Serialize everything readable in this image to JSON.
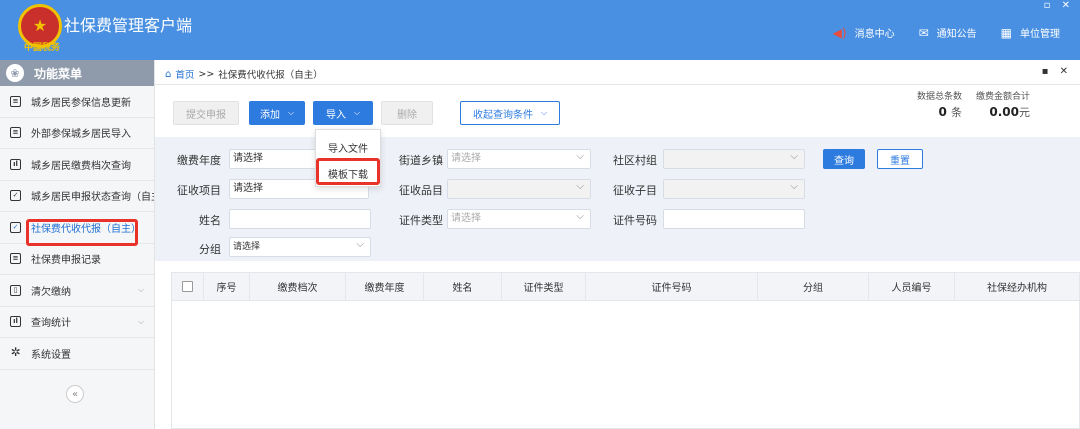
{
  "header": {
    "app_title": "社保费管理客户端",
    "logo_text": "中国税务",
    "messages": "消息中心",
    "notices": "通知公告",
    "unit_mgmt": "单位管理"
  },
  "sidebar": {
    "title": "功能菜单",
    "items": [
      {
        "label": "城乡居民参保信息更新"
      },
      {
        "label": "外部参保城乡居民导入"
      },
      {
        "label": "城乡居民缴费档次查询"
      },
      {
        "label": "城乡居民申报状态查询（自主）"
      },
      {
        "label": "社保费代收代报（自主）"
      },
      {
        "label": "社保费申报记录"
      },
      {
        "label": "清欠缴纳"
      },
      {
        "label": "查询统计"
      },
      {
        "label": "系统设置"
      }
    ]
  },
  "breadcrumb": {
    "home": "首页",
    "separator": ">>",
    "current": "社保费代收代报（自主）"
  },
  "toolbar": {
    "submit": "提交申报",
    "add": "添加",
    "import": "导入",
    "delete": "删除",
    "collapse_query": "收起查询条件"
  },
  "import_menu": {
    "items": [
      "导入文件",
      "模板下载"
    ]
  },
  "stats": {
    "count_label": "数据总条数",
    "count_value": "0",
    "count_unit": "条",
    "amount_label": "缴费金额合计",
    "amount_value": "0.00",
    "amount_unit": "元"
  },
  "filter": {
    "fee_year_label": "缴费年度",
    "fee_year_value": "请选择",
    "street_label": "街道乡镇",
    "street_placeholder": "请选择",
    "village_label": "社区村组",
    "query_btn": "查询",
    "reset_btn": "重置",
    "item_label": "征收项目",
    "item_value": "请选择",
    "category_label": "征收品目",
    "subitem_label": "征收子目",
    "name_label": "姓名",
    "id_type_label": "证件类型",
    "id_type_placeholder": "请选择",
    "id_no_label": "证件号码",
    "group_label": "分组",
    "group_value": "请选择"
  },
  "table": {
    "columns": [
      "序号",
      "缴费档次",
      "缴费年度",
      "姓名",
      "证件类型",
      "证件号码",
      "分组",
      "人员编号",
      "社保经办机构"
    ]
  }
}
